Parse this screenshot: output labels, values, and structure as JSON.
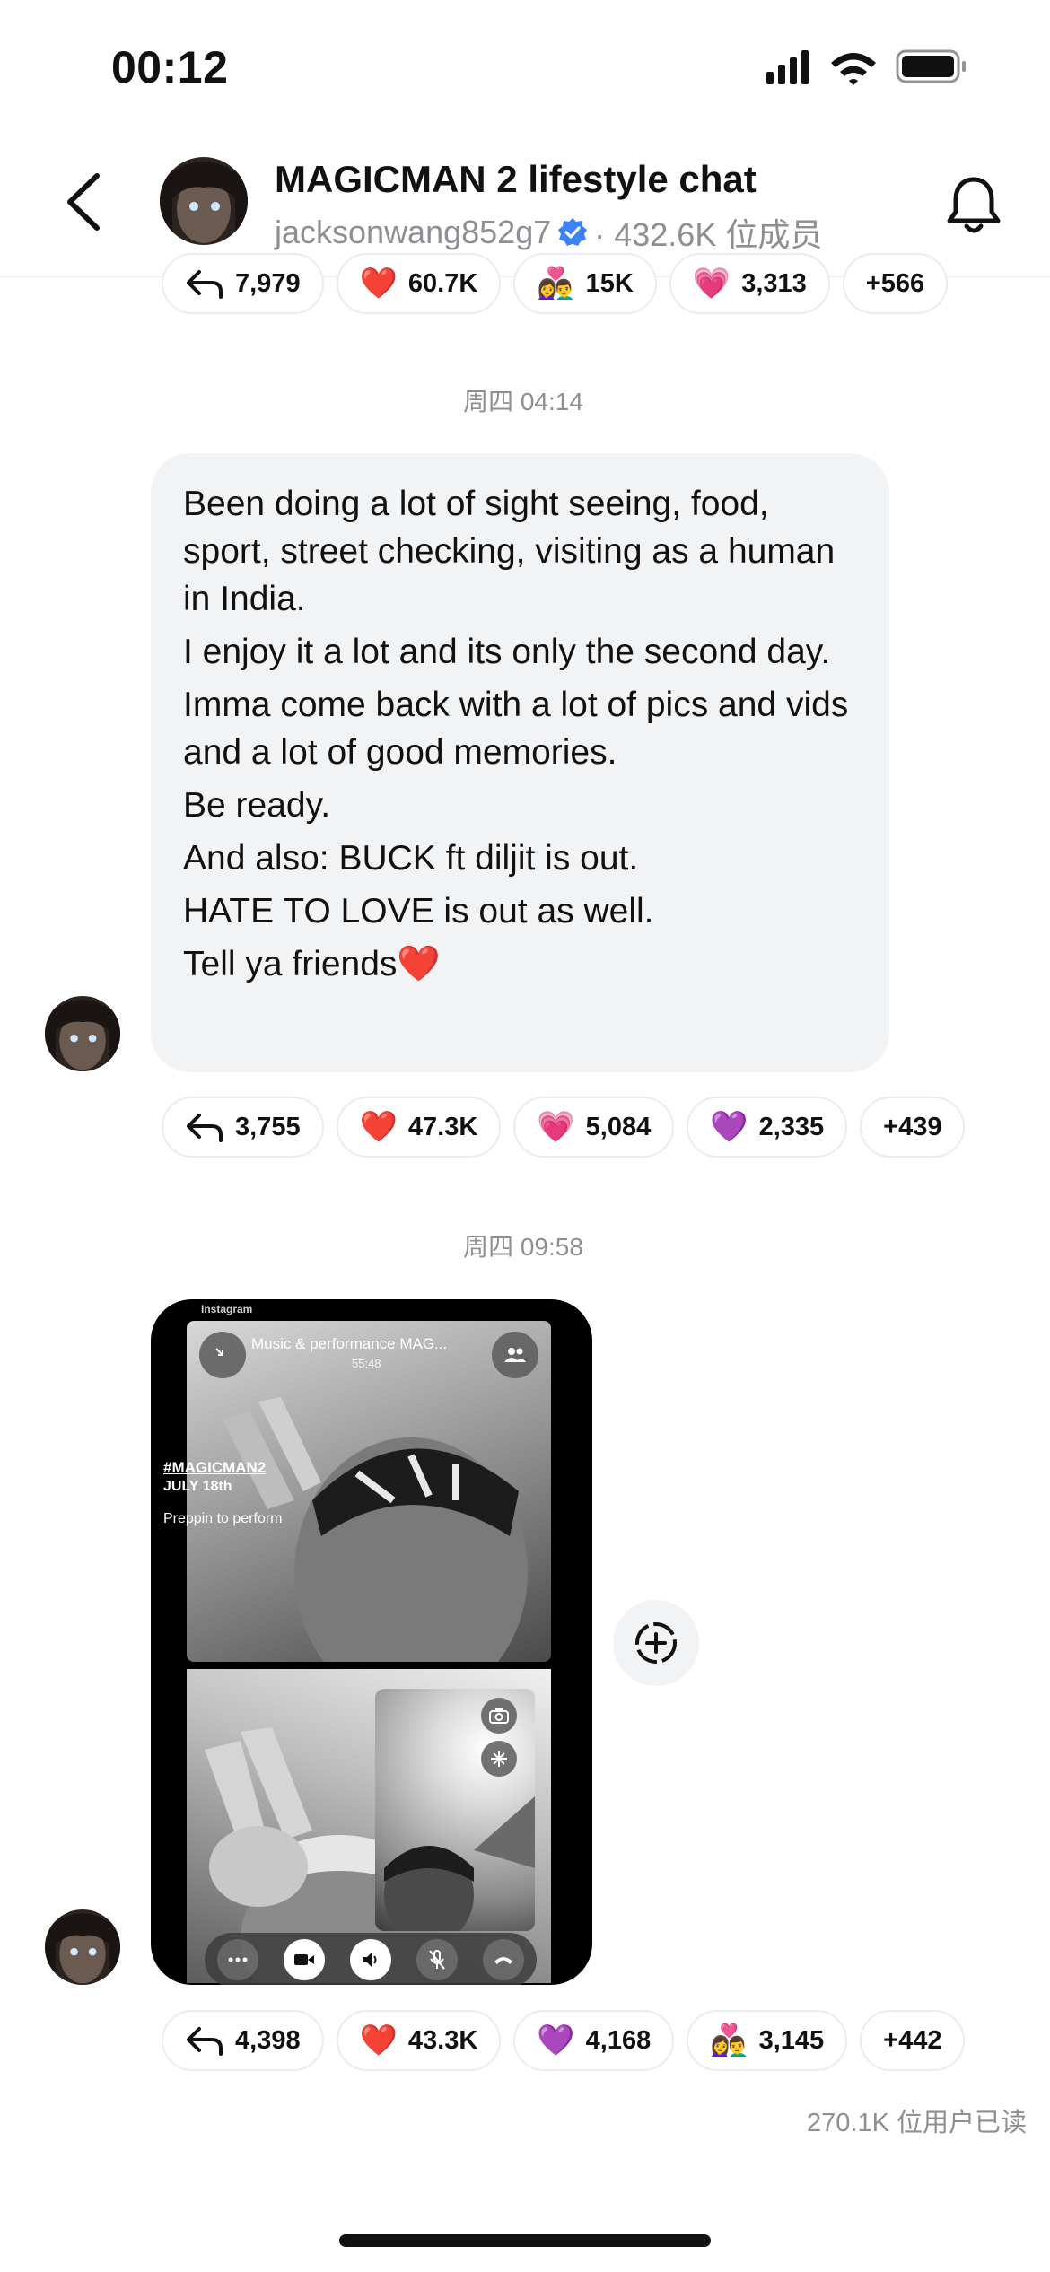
{
  "status_bar": {
    "time": "00:12"
  },
  "header": {
    "title": "MAGICMAN 2 lifestyle chat",
    "username": "jacksonwang852g7",
    "member_count": "· 432.6K 位成员",
    "verified_color": "#3b82f6"
  },
  "top_reactions": [
    {
      "icon": "reply-icon",
      "count": "7,979"
    },
    {
      "icon": "heart",
      "emoji": "❤️",
      "count": "60.7K"
    },
    {
      "icon": "people",
      "emoji": "👩‍❤️‍👨",
      "count": "15K"
    },
    {
      "icon": "pink-heart",
      "emoji": "💗",
      "count": "3,313"
    },
    {
      "icon": "more",
      "count": "+566"
    }
  ],
  "messages": [
    {
      "date": "周四 04:14",
      "lines": [
        "Been doing a lot of sight seeing, food, sport, street checking, visiting as a human in India.",
        "I enjoy it a lot and its only the second day.",
        "Imma come back with a lot of pics and vids and a lot of good memories.",
        "Be ready.",
        "And also: BUCK ft diljit is out.",
        "HATE TO LOVE is out as well.",
        "Tell ya friends❤️"
      ],
      "reactions": [
        {
          "icon": "reply-icon",
          "count": "3,755"
        },
        {
          "icon": "heart",
          "emoji": "❤️",
          "count": "47.3K"
        },
        {
          "icon": "sparkling-heart",
          "emoji": "💗",
          "count": "5,084"
        },
        {
          "icon": "purple-heart",
          "emoji": "💜",
          "count": "2,335"
        },
        {
          "icon": "more",
          "count": "+439"
        }
      ]
    },
    {
      "date": "周四 09:58",
      "video": {
        "source_label": "Instagram",
        "call_title": "Music & performance MAG...",
        "call_timer": "55:48",
        "overlay_hashtag": "#MAGICMAN2",
        "overlay_date": "JULY 18th",
        "overlay_caption": "Preppin to perform"
      },
      "reactions": [
        {
          "icon": "reply-icon",
          "count": "4,398"
        },
        {
          "icon": "heart",
          "emoji": "❤️",
          "count": "43.3K"
        },
        {
          "icon": "purple-heart",
          "emoji": "💜",
          "count": "4,168"
        },
        {
          "icon": "people",
          "emoji": "👩‍❤️‍👨",
          "count": "3,145"
        },
        {
          "icon": "more",
          "count": "+442"
        }
      ]
    }
  ],
  "read_receipt": "270.1K 位用户已读"
}
